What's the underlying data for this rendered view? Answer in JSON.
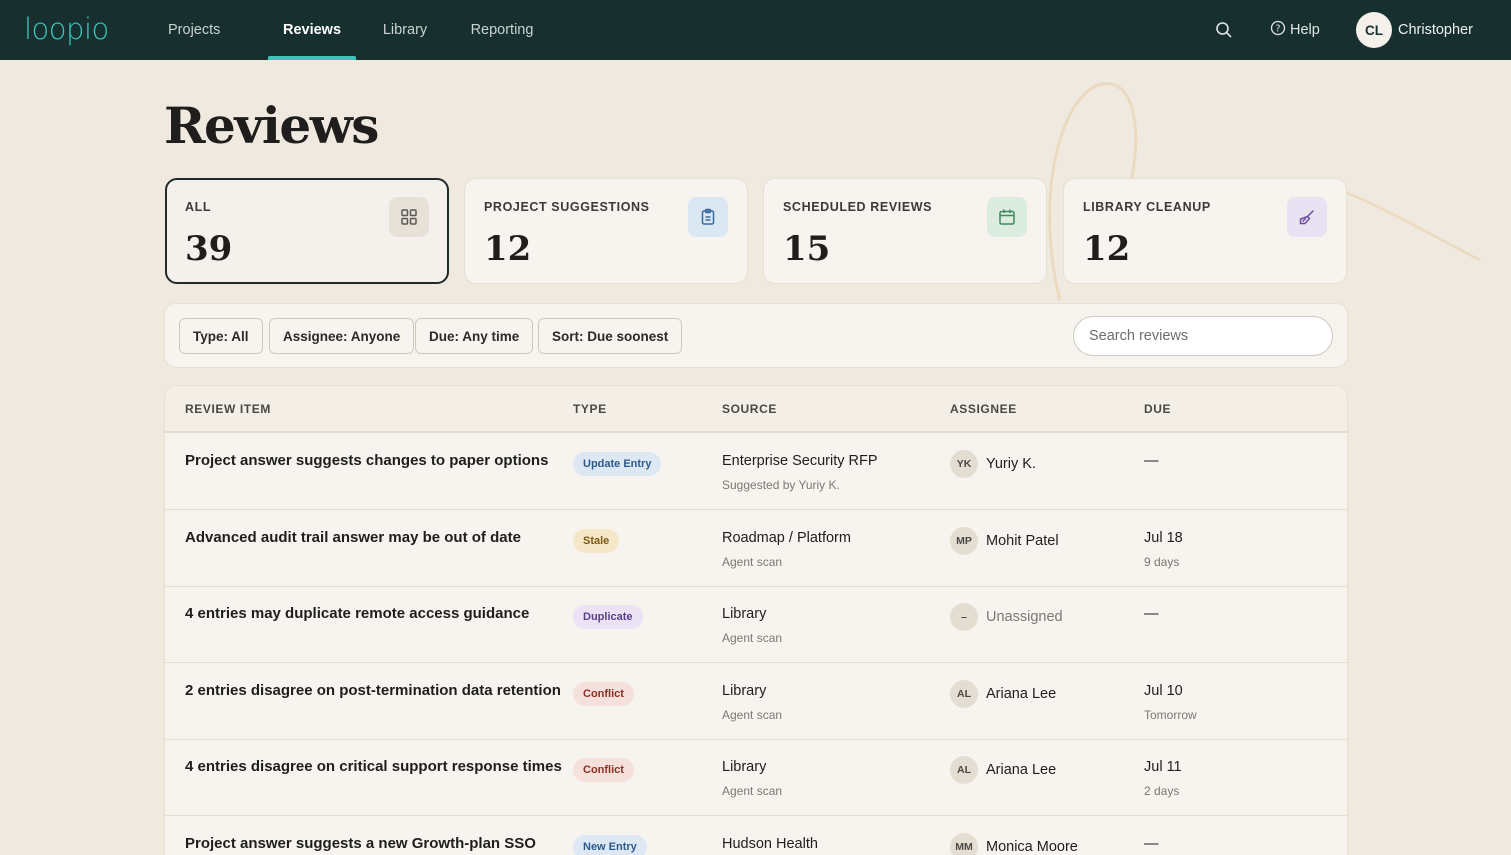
{
  "app": {
    "logo_text": "loopio"
  },
  "nav": {
    "items": [
      {
        "label": "Projects",
        "active": false
      },
      {
        "label": "Reviews",
        "active": true
      },
      {
        "label": "Library",
        "active": false
      },
      {
        "label": "Reporting",
        "active": false
      }
    ]
  },
  "topbar": {
    "help_label": "Help",
    "user_initials": "CL",
    "user_name": "Christopher"
  },
  "page": {
    "title": "Reviews"
  },
  "cards": [
    {
      "label": "ALL",
      "count": "39",
      "icon": "grid-icon",
      "icon_bg": "#e7e1d8",
      "icon_color": "#5b5955",
      "selected": true
    },
    {
      "label": "PROJECT SUGGESTIONS",
      "count": "12",
      "icon": "clipboard-icon",
      "icon_bg": "#dbe7f3",
      "icon_color": "#3b6c9e",
      "selected": false
    },
    {
      "label": "SCHEDULED REVIEWS",
      "count": "15",
      "icon": "calendar-icon",
      "icon_bg": "#dcece1",
      "icon_color": "#3f8a5b",
      "selected": false
    },
    {
      "label": "LIBRARY CLEANUP",
      "count": "12",
      "icon": "broom-icon",
      "icon_bg": "#e9e2f3",
      "icon_color": "#6b4ea0",
      "selected": false
    }
  ],
  "filters": {
    "chips": [
      "Type: All",
      "Assignee: Anyone",
      "Due: Any time",
      "Sort: Due soonest"
    ],
    "search_placeholder": "Search reviews",
    "search_value": ""
  },
  "table": {
    "headers": [
      "REVIEW ITEM",
      "TYPE",
      "SOURCE",
      "ASSIGNEE",
      "DUE"
    ],
    "rows": [
      {
        "title": "Project answer suggests changes to paper options",
        "type": "Update Entry",
        "type_bg": "#dde8f4",
        "type_color": "#2c5a8a",
        "source": "Enterprise Security RFP",
        "source_sub": "Suggested by Yuriy K.",
        "initials": "YK",
        "assignee": "Yuriy K.",
        "assignee_muted": false,
        "due": "—",
        "due_sub": ""
      },
      {
        "title": "Advanced audit trail answer may be out of date",
        "type": "Stale",
        "type_bg": "#f6e7c9",
        "type_color": "#7a5a14",
        "source": "Roadmap / Platform",
        "source_sub": "Agent scan",
        "initials": "MP",
        "assignee": "Mohit Patel",
        "assignee_muted": false,
        "due": "Jul 18",
        "due_sub": "9 days"
      },
      {
        "title": "4 entries may duplicate remote access guidance",
        "type": "Duplicate",
        "type_bg": "#ebe3f4",
        "type_color": "#5b3e8c",
        "source": "Library",
        "source_sub": "Agent scan",
        "initials": "–",
        "assignee": "Unassigned",
        "assignee_muted": true,
        "due": "—",
        "due_sub": ""
      },
      {
        "title": "2 entries disagree on post-termination data retention",
        "type": "Conflict",
        "type_bg": "#f6e0dc",
        "type_color": "#8c2f22",
        "source": "Library",
        "source_sub": "Agent scan",
        "initials": "AL",
        "assignee": "Ariana Lee",
        "assignee_muted": false,
        "due": "Jul 10",
        "due_sub": "Tomorrow"
      },
      {
        "title": "4 entries disagree on critical support response times",
        "type": "Conflict",
        "type_bg": "#f6e0dc",
        "type_color": "#8c2f22",
        "source": "Library",
        "source_sub": "Agent scan",
        "initials": "AL",
        "assignee": "Ariana Lee",
        "assignee_muted": false,
        "due": "Jul 11",
        "due_sub": "2 days"
      },
      {
        "title": "Project answer suggests a new Growth-plan SSO",
        "type": "New Entry",
        "type_bg": "#dde8f4",
        "type_color": "#2c5a8a",
        "source": "Hudson Health",
        "source_sub": "",
        "initials": "MM",
        "assignee": "Monica Moore",
        "assignee_muted": false,
        "due": "—",
        "due_sub": ""
      }
    ]
  }
}
